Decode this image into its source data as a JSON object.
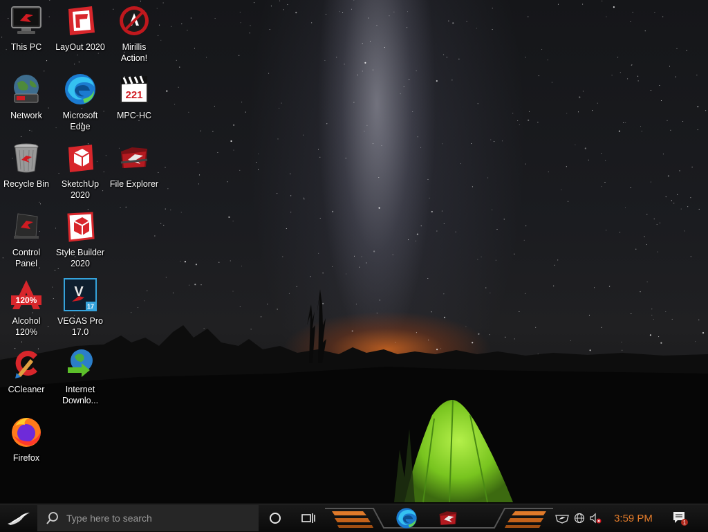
{
  "desktop": {
    "icons": [
      {
        "id": "this-pc",
        "label": "This PC",
        "icon": "this-pc-icon"
      },
      {
        "id": "layout-2020",
        "label": "LayOut 2020",
        "icon": "layout-icon"
      },
      {
        "id": "mirillis-action",
        "label": "Mirillis\nAction!",
        "icon": "mirillis-icon"
      },
      {
        "id": "network",
        "label": "Network",
        "icon": "network-icon"
      },
      {
        "id": "microsoft-edge",
        "label": "Microsoft\nEdge",
        "icon": "edge-icon"
      },
      {
        "id": "mpc-hc",
        "label": "MPC-HC",
        "icon": "mpc-hc-icon"
      },
      {
        "id": "recycle-bin",
        "label": "Recycle Bin",
        "icon": "recycle-bin-icon"
      },
      {
        "id": "sketchup-2020",
        "label": "SketchUp\n2020",
        "icon": "sketchup-icon"
      },
      {
        "id": "file-explorer",
        "label": "File Explorer",
        "icon": "file-explorer-icon"
      },
      {
        "id": "control-panel",
        "label": "Control\nPanel",
        "icon": "control-panel-icon"
      },
      {
        "id": "style-builder-2020",
        "label": "Style Builder\n2020",
        "icon": "style-builder-icon"
      },
      {
        "id": "alcohol-120",
        "label": "Alcohol\n120%",
        "icon": "alcohol-icon"
      },
      {
        "id": "vegas-pro-17",
        "label": "VEGAS Pro\n17.0",
        "icon": "vegas-icon"
      },
      {
        "id": "ccleaner",
        "label": "CCleaner",
        "icon": "ccleaner-icon"
      },
      {
        "id": "internet-download-manager",
        "label": "Internet\nDownlo...",
        "icon": "idm-icon"
      },
      {
        "id": "firefox",
        "label": "Firefox",
        "icon": "firefox-icon"
      }
    ],
    "icon_glyphs": {
      "alcohol": "120%",
      "mpc": "221",
      "vegas_letter": "V",
      "vegas_version": "17"
    }
  },
  "taskbar": {
    "search_placeholder": "Type here to search",
    "clock": "3:59 PM",
    "notification_count": "1",
    "pinned": [
      "edge-icon",
      "file-explorer-icon"
    ],
    "tray": [
      "rog-tray-icon",
      "network-globe-icon",
      "volume-muted-icon"
    ]
  },
  "colors": {
    "accent_orange": "#e07a2a",
    "rog_red": "#d01b22",
    "tent_green": "#7fcf2a"
  }
}
